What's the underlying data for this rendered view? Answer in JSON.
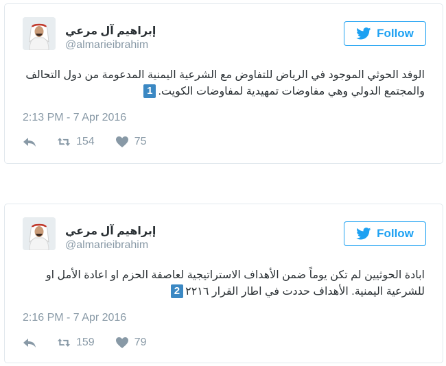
{
  "tweets": [
    {
      "display_name": "إبراهيم آل مرعي",
      "handle": "@almarieibrahim",
      "follow_label": "Follow",
      "text": "الوفد الحوثي الموجود في الرياض للتفاوض مع الشرعية اليمنية المدعومة من دول التحالف والمجتمع الدولي وهي مفاوضات تمهيدية لمفاوضات الكويت.",
      "badge": "1",
      "timestamp": "2:13 PM - 7 Apr 2016",
      "retweets": "154",
      "likes": "75"
    },
    {
      "display_name": "إبراهيم آل مرعي",
      "handle": "@almarieibrahim",
      "follow_label": "Follow",
      "text": "ابادة الحوثيين لم تكن يوماً ضمن الأهداف الاستراتيجية لعاصفة الحزم او اعادة الأمل او للشرعية اليمنية. الأهداف حددت في اطار القرار ٢٢١٦",
      "badge": "2",
      "timestamp": "2:16 PM - 7 Apr 2016",
      "retweets": "159",
      "likes": "79"
    }
  ],
  "colors": {
    "accent": "#1da1f2",
    "muted": "#8899a6",
    "badge": "#3b88c3",
    "border": "#e1e8ed"
  },
  "icons": [
    "twitter-bird-icon",
    "reply-icon",
    "retweet-icon",
    "heart-icon"
  ]
}
